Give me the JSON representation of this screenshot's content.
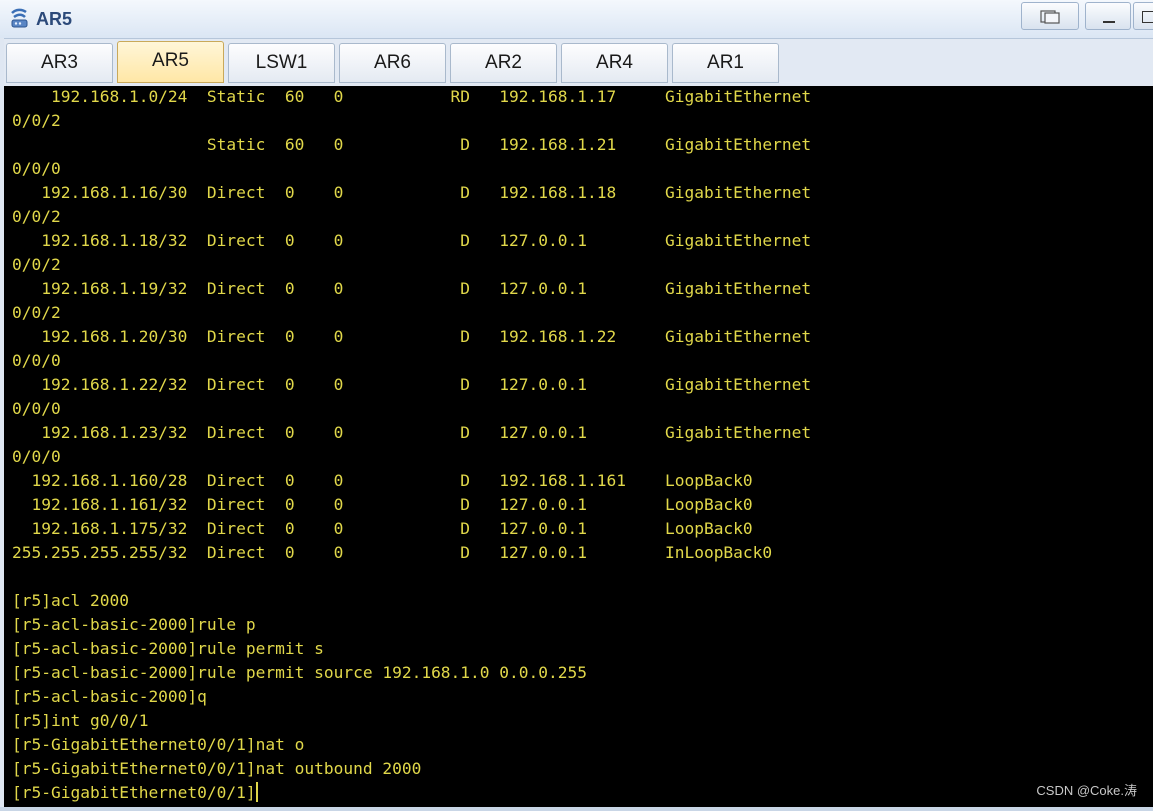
{
  "window": {
    "title": "AR5",
    "icon": "router-app-icon",
    "controls": [
      "restore",
      "minimize",
      "maximize"
    ]
  },
  "tabs": [
    {
      "label": "AR3",
      "active": false
    },
    {
      "label": "AR5",
      "active": true
    },
    {
      "label": "LSW1",
      "active": false
    },
    {
      "label": "AR6",
      "active": false
    },
    {
      "label": "AR2",
      "active": false
    },
    {
      "label": "AR4",
      "active": false
    },
    {
      "label": "AR1",
      "active": false
    }
  ],
  "terminal": {
    "lines": [
      "    192.168.1.0/24  Static  60   0           RD   192.168.1.17     GigabitEthernet",
      "0/0/2",
      "                    Static  60   0            D   192.168.1.21     GigabitEthernet",
      "0/0/0",
      "   192.168.1.16/30  Direct  0    0            D   192.168.1.18     GigabitEthernet",
      "0/0/2",
      "   192.168.1.18/32  Direct  0    0            D   127.0.0.1        GigabitEthernet",
      "0/0/2",
      "   192.168.1.19/32  Direct  0    0            D   127.0.0.1        GigabitEthernet",
      "0/0/2",
      "   192.168.1.20/30  Direct  0    0            D   192.168.1.22     GigabitEthernet",
      "0/0/0",
      "   192.168.1.22/32  Direct  0    0            D   127.0.0.1        GigabitEthernet",
      "0/0/0",
      "   192.168.1.23/32  Direct  0    0            D   127.0.0.1        GigabitEthernet",
      "0/0/0",
      "  192.168.1.160/28  Direct  0    0            D   192.168.1.161    LoopBack0",
      "  192.168.1.161/32  Direct  0    0            D   127.0.0.1        LoopBack0",
      "  192.168.1.175/32  Direct  0    0            D   127.0.0.1        LoopBack0",
      "255.255.255.255/32  Direct  0    0            D   127.0.0.1        InLoopBack0",
      "",
      "[r5]acl 2000",
      "[r5-acl-basic-2000]rule p",
      "[r5-acl-basic-2000]rule permit s",
      "[r5-acl-basic-2000]rule permit source 192.168.1.0 0.0.0.255",
      "[r5-acl-basic-2000]q",
      "[r5]int g0/0/1",
      "[r5-GigabitEthernet0/0/1]nat o",
      "[r5-GigabitEthernet0/0/1]nat outbound 2000",
      "[r5-GigabitEthernet0/0/1]"
    ],
    "text_color": "#e1d84a",
    "background_color": "#000000"
  },
  "watermark": "CSDN @Coke.涛"
}
